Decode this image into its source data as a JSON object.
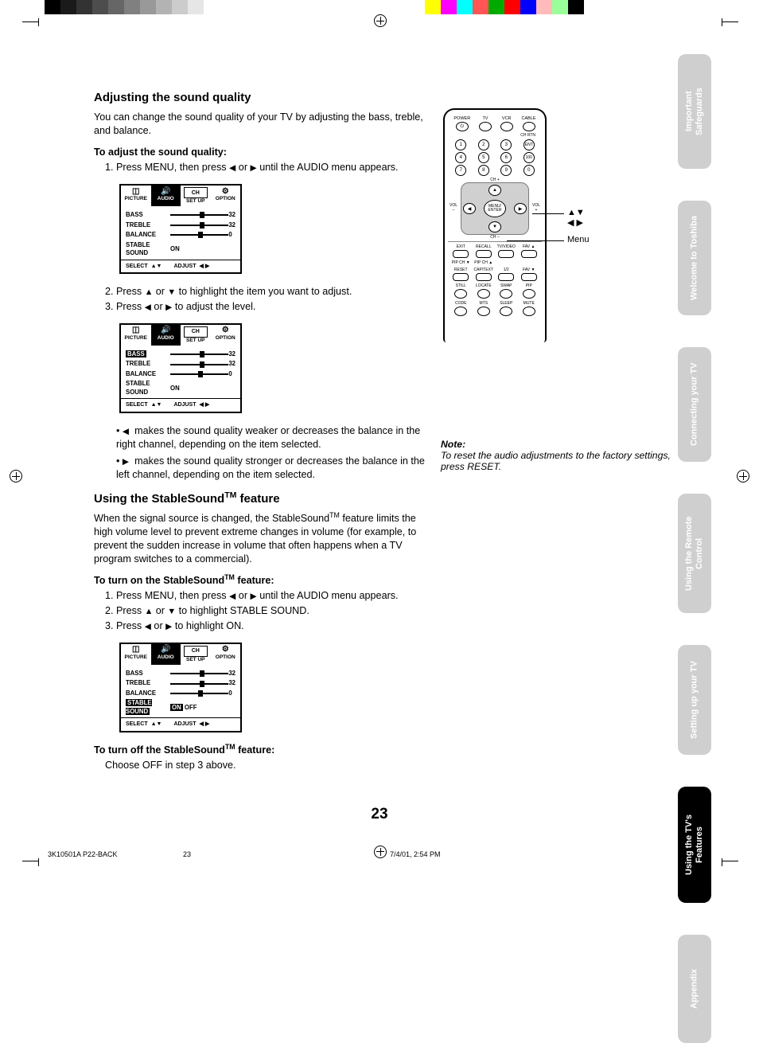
{
  "page_number": "23",
  "footer": {
    "doc_id": "3K10501A P22-BACK",
    "page": "23",
    "datetime": "7/4/01, 2:54 PM"
  },
  "side_tabs": [
    "Important Safeguards",
    "Welcome to Toshiba",
    "Connecting your TV",
    "Using the Remote Control",
    "Setting up your TV",
    "Using the TV's Features",
    "Appendix"
  ],
  "section1": {
    "heading": "Adjusting the sound quality",
    "intro": "You can change the sound quality of your TV by adjusting the bass, treble, and balance.",
    "subhead": "To adjust the sound quality:",
    "step1_a": "Press MENU, then press ",
    "step1_b": " or ",
    "step1_c": " until the AUDIO menu appears.",
    "step2_a": "Press ",
    "step2_b": " or ",
    "step2_c": " to highlight the item you want to adjust.",
    "step3_a": "Press ",
    "step3_b": " or ",
    "step3_c": " to adjust the level.",
    "bullet1_a": " makes the sound quality weaker or decreases the balance in the right channel, depending on the item selected.",
    "bullet2_a": " makes the sound quality stronger or decreases the balance in the left channel, depending on the item selected."
  },
  "section2": {
    "heading_a": "Using the StableSound",
    "heading_b": " feature",
    "intro_a": "When the signal source is changed, the StableSound",
    "intro_b": " feature limits the high volume level to prevent extreme changes in volume (for example, to prevent the sudden increase in volume that often happens when a TV program switches to a commercial).",
    "subhead_a": "To turn on the StableSound",
    "subhead_b": " feature:",
    "step1_a": "Press MENU, then press ",
    "step1_b": " or ",
    "step1_c": " until the AUDIO menu appears.",
    "step2_a": "Press ",
    "step2_b": " or ",
    "step2_c": " to highlight STABLE SOUND.",
    "step3_a": "Press ",
    "step3_b": " or ",
    "step3_c": " to highlight ON.",
    "off_head_a": "To turn off the StableSound",
    "off_head_b": " feature:",
    "off_body": "Choose OFF in step 3 above."
  },
  "osd": {
    "tabs": {
      "picture": "PICTURE",
      "audio": "AUDIO",
      "setup": "SET UP",
      "option": "OPTION"
    },
    "rows": {
      "bass": "BASS",
      "treble": "TREBLE",
      "balance": "BALANCE",
      "stable": "STABLE SOUND"
    },
    "vals": {
      "bass": "32",
      "treble": "32",
      "balance": "0",
      "stable_on": "ON",
      "on": "ON",
      "off": "OFF"
    },
    "footer": {
      "select": "SELECT",
      "adjust": "ADJUST"
    }
  },
  "remote": {
    "row1": [
      "POWER",
      "TV",
      "VCR",
      "CABLE"
    ],
    "chrtn": "CH RTN",
    "nums": [
      "1",
      "2",
      "3",
      "ENT",
      "4",
      "5",
      "6",
      "100",
      "7",
      "8",
      "9",
      "0"
    ],
    "dpad": {
      "menu": "MENU/",
      "enter": "ENTER",
      "chp": "CH +",
      "chm": "CH –",
      "volp": "+",
      "volm": "–",
      "volL": "VOL",
      "volR": "VOL"
    },
    "grid1": [
      {
        "t": "EXIT"
      },
      {
        "t": "RECALL"
      },
      {
        "t": "TV/VIDEO"
      },
      {
        "t": "FAV ▲"
      },
      {
        "t": "PIP CH ▼"
      },
      {
        "t": "PIP CH ▲"
      },
      {
        "t": ""
      },
      {
        "t": ""
      },
      {
        "t": "RESET"
      },
      {
        "t": "CAP/TEXT"
      },
      {
        "t": "1/2"
      },
      {
        "t": "FAV ▼"
      },
      {
        "t": "STILL"
      },
      {
        "t": "LOCATE"
      },
      {
        "t": "SWAP"
      },
      {
        "t": "PIP"
      },
      {
        "t": "CODE"
      },
      {
        "t": "MTS"
      },
      {
        "t": "SLEEP"
      },
      {
        "t": "MUTE"
      }
    ],
    "callout1": "▲▼ ◀ ▶",
    "callout2": "Menu"
  },
  "note": {
    "head": "Note:",
    "body": "To reset the audio adjustments to the factory settings, press RESET."
  }
}
